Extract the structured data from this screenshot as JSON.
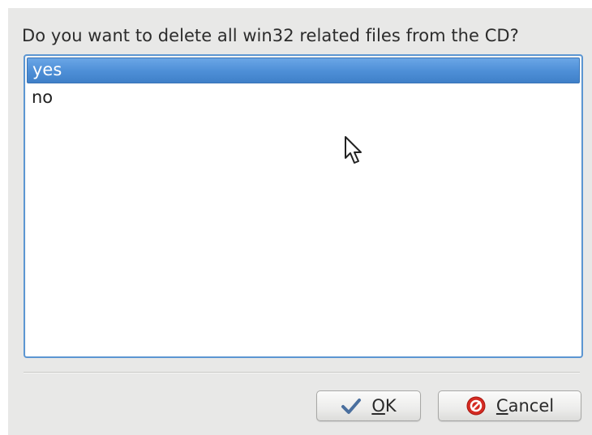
{
  "dialog": {
    "prompt": "Do you want to delete all win32 related files from the CD?",
    "options": [
      {
        "label": "yes",
        "selected": true
      },
      {
        "label": "no",
        "selected": false
      }
    ],
    "buttons": {
      "ok": {
        "mnemonic": "O",
        "rest": "K",
        "icon": "checkmark-icon"
      },
      "cancel": {
        "mnemonic": "C",
        "rest": "ancel",
        "icon": "cancel-icon"
      }
    }
  },
  "colors": {
    "selection": "#4d8ed6",
    "list_border": "#5c96d2",
    "dialog_bg": "#e8e8e7",
    "cancel_icon": "#d42a22",
    "ok_icon": "#4a6f9e"
  }
}
